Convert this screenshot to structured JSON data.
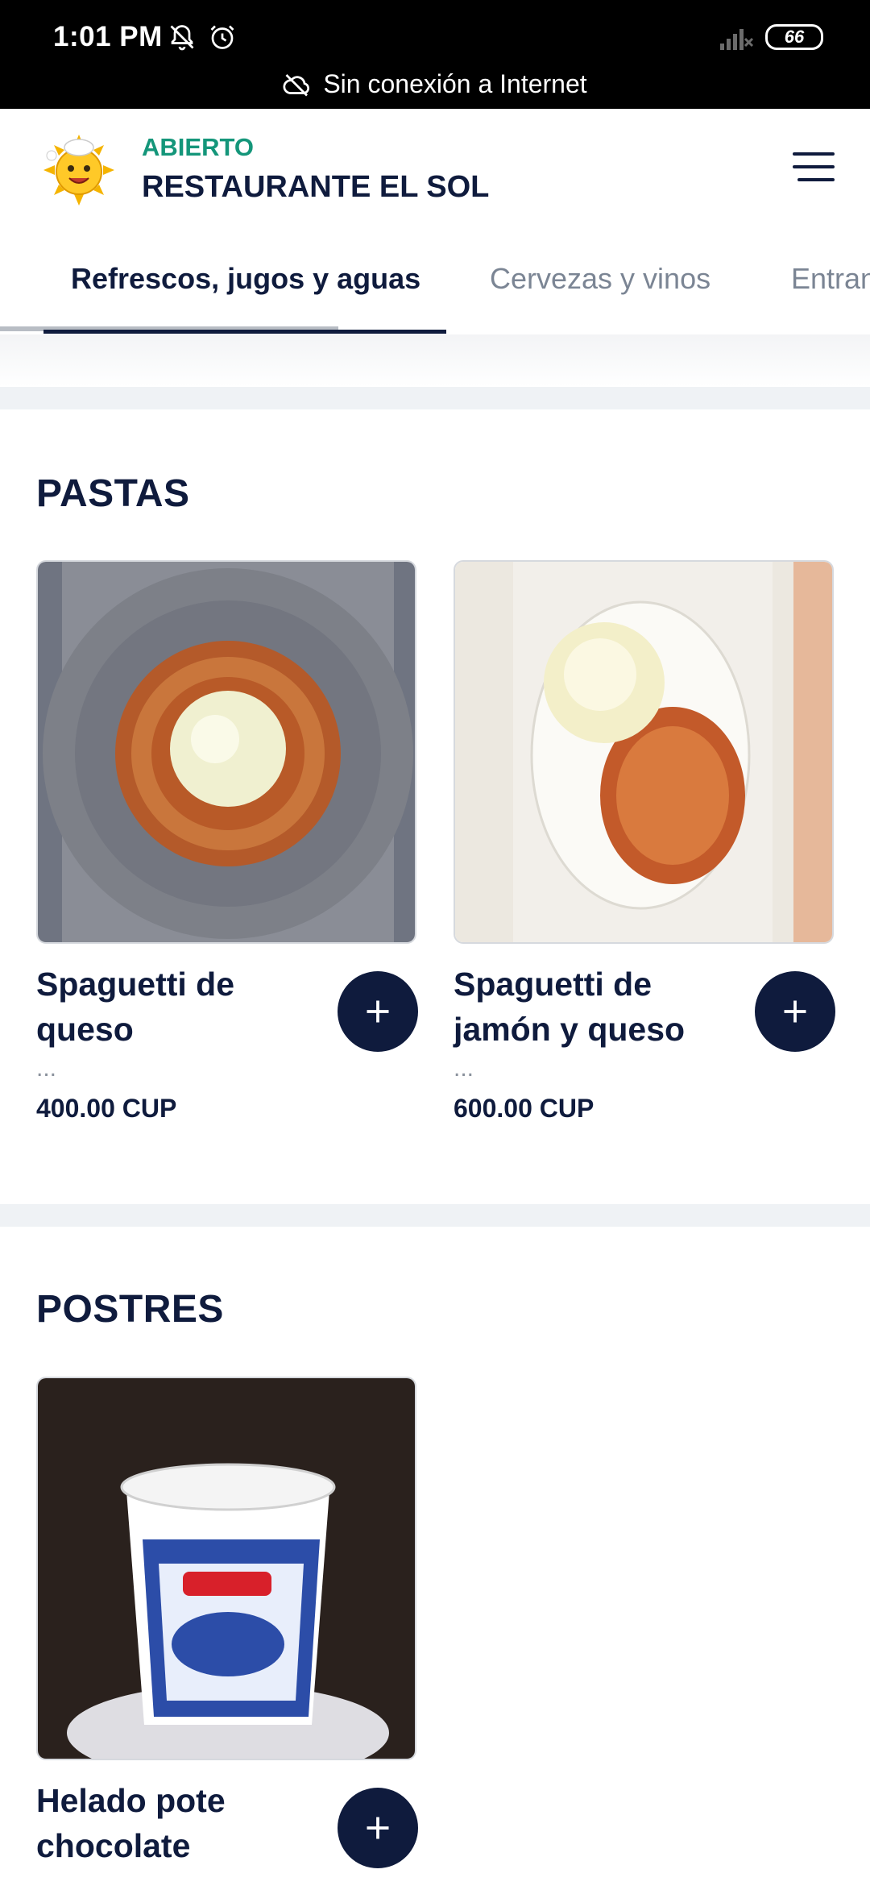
{
  "status_bar": {
    "time": "1:01 PM",
    "battery": "66",
    "offline_message": "Sin conexión a Internet"
  },
  "header": {
    "status": "ABIERTO",
    "restaurant_name": "RESTAURANTE EL SOL"
  },
  "tabs": [
    {
      "label": "Refrescos, jugos y aguas",
      "active": true
    },
    {
      "label": "Cervezas y vinos",
      "active": false
    },
    {
      "label": "Entrantes",
      "active": false
    }
  ],
  "sections": [
    {
      "title": "PASTAS",
      "products": [
        {
          "name": "Spaguetti de queso",
          "description": "...",
          "price": "400.00 CUP"
        },
        {
          "name": "Spaguetti de jamón y queso",
          "description": "...",
          "price": "600.00 CUP"
        }
      ]
    },
    {
      "title": "POSTRES",
      "products": [
        {
          "name": "Helado pote chocolate"
        }
      ]
    }
  ],
  "colors": {
    "primary": "#0f1b3d",
    "open_status": "#14967a",
    "muted": "#7b8594"
  }
}
